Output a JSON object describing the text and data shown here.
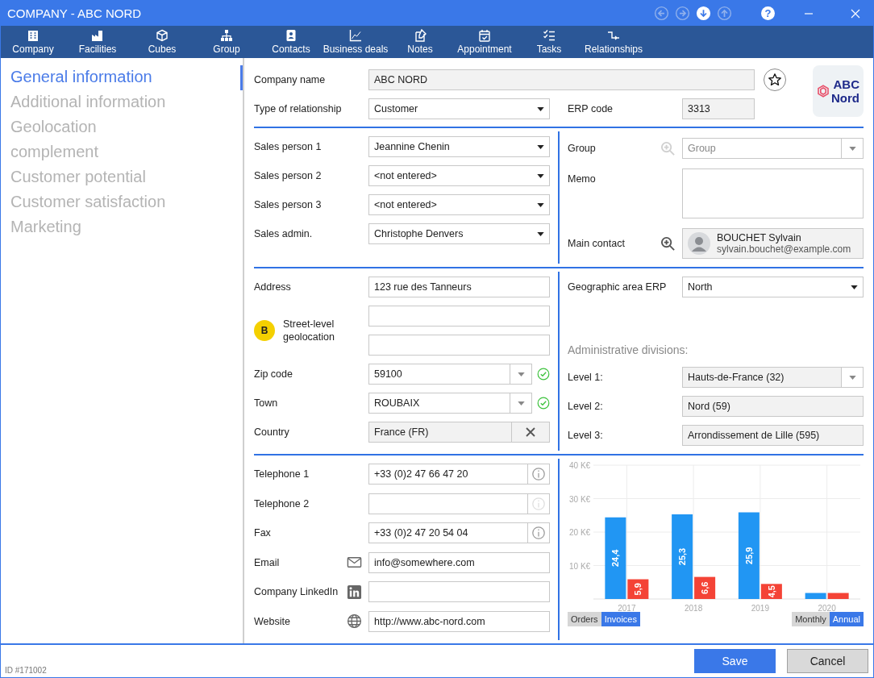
{
  "window": {
    "title": "COMPANY - ABC NORD",
    "help": "?",
    "nav": [
      {
        "disabled": true
      },
      {
        "disabled": true
      },
      {
        "disabled": false
      },
      {
        "disabled": true
      }
    ]
  },
  "toolbar": [
    {
      "label": "Company"
    },
    {
      "label": "Facilities"
    },
    {
      "label": "Cubes"
    },
    {
      "label": "Group"
    },
    {
      "label": "Contacts"
    },
    {
      "label": "Business deals"
    },
    {
      "label": "Notes"
    },
    {
      "label": "Appointment"
    },
    {
      "label": "Tasks"
    },
    {
      "label": "Relationships"
    }
  ],
  "sidebar": {
    "items": [
      {
        "label": "General information",
        "selected": true
      },
      {
        "label": "Additional information",
        "selected": false
      },
      {
        "label": "Geolocation",
        "selected": false
      },
      {
        "label": "complement",
        "selected": false
      },
      {
        "label": "Customer potential",
        "selected": false
      },
      {
        "label": "Customer satisfaction",
        "selected": false
      },
      {
        "label": "Marketing",
        "selected": false
      }
    ]
  },
  "header": {
    "company_name": {
      "label": "Company name",
      "value": "ABC NORD"
    },
    "favorite": false,
    "relationship": {
      "label": "Type of relationship",
      "value": "Customer"
    },
    "erp_code": {
      "label": "ERP code",
      "value": "3313"
    },
    "logo": {
      "line_1": "ABC",
      "line_2": "Nord"
    }
  },
  "sections": [
    {
      "left": [
        {
          "kind": "select",
          "label": "Sales person 1",
          "value": "Jeannine Chenin"
        },
        {
          "kind": "select",
          "label": "Sales person 2",
          "value": "<not entered>"
        },
        {
          "kind": "select",
          "label": "Sales person 3",
          "value": "<not entered>"
        },
        {
          "kind": "select",
          "label": "Sales admin.",
          "value": "Christophe Denvers"
        }
      ],
      "right": [
        {
          "kind": "lookup",
          "label": "Group",
          "placeholder": "Group",
          "lookup_enabled": false
        },
        {
          "kind": "memo",
          "label": "Memo"
        },
        {
          "kind": "contact",
          "label": "Main contact",
          "lookup_enabled": true,
          "name": "BOUCHET Sylvain",
          "email": "sylvain.bouchet@example.com"
        }
      ]
    },
    {
      "left": [
        {
          "kind": "input",
          "label": "Address",
          "value": "123 rue des Tanneurs"
        },
        {
          "kind": "geolocation",
          "badge": "B",
          "label": "Street-level geolocation"
        },
        {
          "kind": "combo",
          "label": "Zip code",
          "value": "59100",
          "readonly": false,
          "valid": true
        },
        {
          "kind": "combo",
          "label": "Town",
          "value": "ROUBAIX",
          "readonly": false,
          "valid": true
        },
        {
          "kind": "clearable",
          "label": "Country",
          "value": "France (FR)"
        }
      ],
      "right": [
        {
          "kind": "select",
          "label": "Geographic area ERP",
          "value": "North"
        },
        {
          "kind": "heading",
          "label": "Administrative divisions:"
        },
        {
          "kind": "combo",
          "label": "Level 1:",
          "value": "Hauts-de-France (32)",
          "readonly": true,
          "valid": false
        },
        {
          "kind": "readonly",
          "label": "Level 2:",
          "value": "Nord (59)"
        },
        {
          "kind": "readonly",
          "label": "Level 3:",
          "value": "Arrondissement de Lille (595)"
        }
      ]
    },
    {
      "left": [
        {
          "kind": "phone",
          "label": "Telephone 1",
          "value": "+33 (0)2 47 66 47 20",
          "info_enabled": true
        },
        {
          "kind": "phone",
          "label": "Telephone 2",
          "info_enabled": false
        },
        {
          "kind": "phone",
          "label": "Fax",
          "value": "+33 (0)2 47 20 54 04",
          "info_enabled": true
        },
        {
          "kind": "email",
          "label": "Email",
          "value": "info@somewhere.com"
        },
        {
          "kind": "linkedin",
          "label": "Company LinkedIn"
        },
        {
          "kind": "website",
          "label": "Website",
          "value": "http://www.abc-nord.com"
        }
      ],
      "right": [
        {
          "kind": "chart",
          "chart_data": {
            "type": "bar",
            "categories": [
              "2017",
              "2018",
              "2019",
              "2020"
            ],
            "series": [
              {
                "color": "#2196f3",
                "values": [
                  24.4,
                  25.3,
                  25.9,
                  1.8
                ]
              },
              {
                "color": "#f44336",
                "values": [
                  5.9,
                  6.6,
                  4.5,
                  1.8
                ]
              }
            ],
            "value_labels": [
              [
                "24,4",
                "25,3",
                "25,9",
                null
              ],
              [
                "5,9",
                "6,6",
                "4,5",
                null
              ]
            ],
            "ylim": [
              0,
              40
            ],
            "grid": true,
            "yticks": [
              {
                "value": 10,
                "label": "10 K€"
              },
              {
                "value": 20,
                "label": "20 K€"
              },
              {
                "value": 30,
                "label": "30 K€"
              },
              {
                "value": 40,
                "label": "40 K€"
              }
            ]
          },
          "series_toggle": [
            {
              "label": "Orders",
              "selected": false
            },
            {
              "label": "Invoices",
              "selected": true
            }
          ],
          "period_toggle": [
            {
              "label": "Monthly",
              "selected": false
            },
            {
              "label": "Annual",
              "selected": true
            }
          ]
        }
      ]
    }
  ],
  "footer": {
    "id": "ID #171002",
    "buttons": [
      {
        "label": "Save",
        "kind": "primary"
      },
      {
        "label": "Cancel",
        "kind": "secondary"
      }
    ]
  }
}
